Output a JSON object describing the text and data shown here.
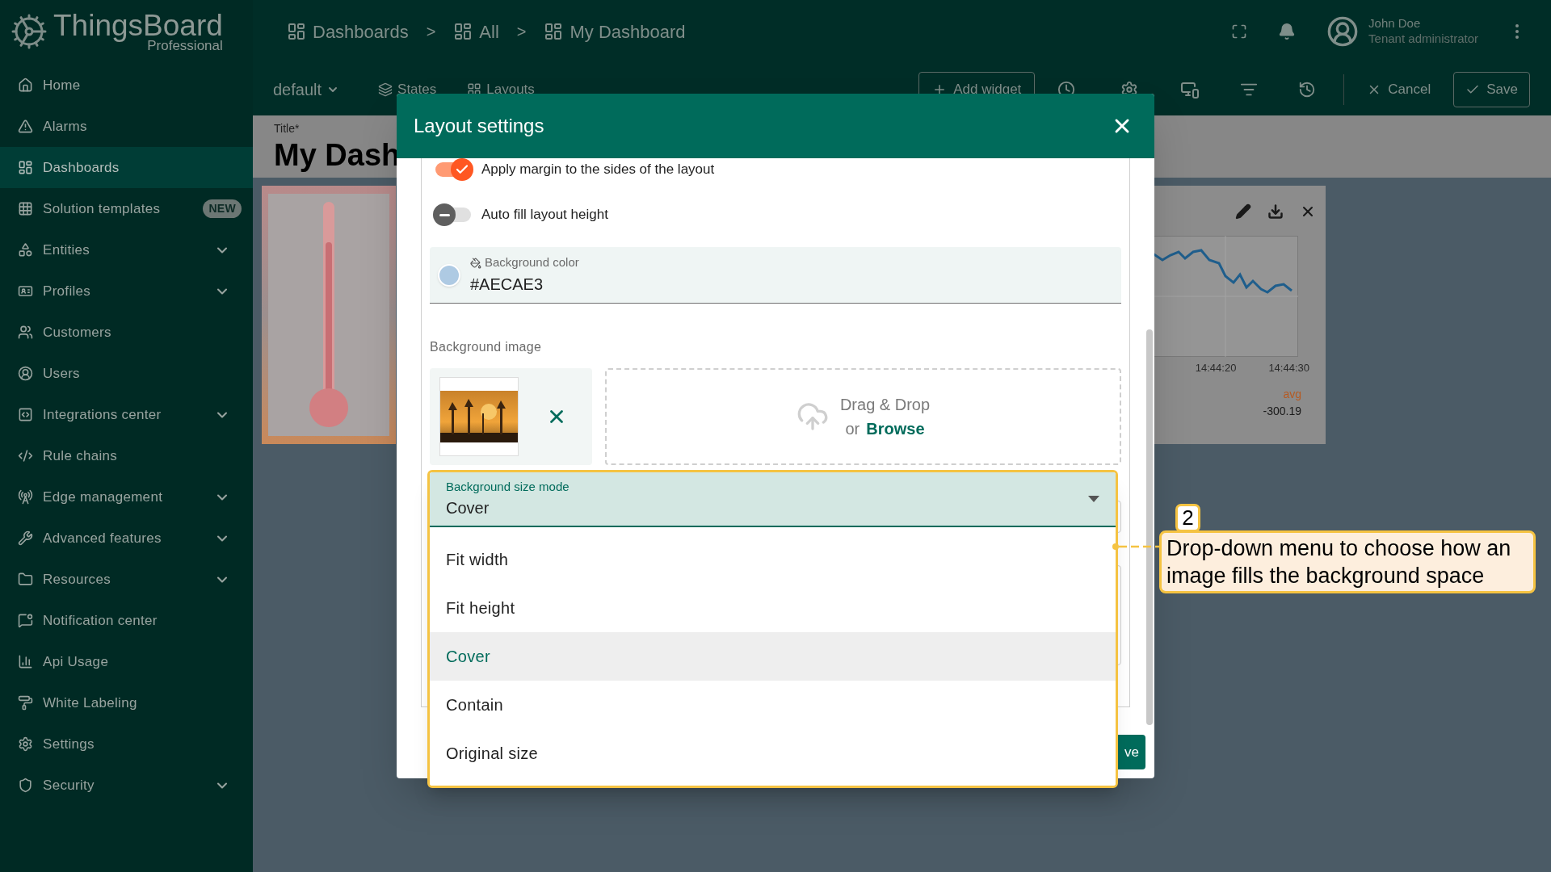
{
  "header": {
    "logo": {
      "name": "ThingsBoard",
      "edition": "Professional"
    },
    "breadcrumbs": [
      {
        "kind": "crumb",
        "label": "Dashboards"
      },
      {
        "kind": "separator",
        "label": ">"
      },
      {
        "kind": "crumb",
        "label": "All"
      },
      {
        "kind": "separator",
        "label": ">"
      },
      {
        "kind": "crumb",
        "label": "My Dashboard"
      }
    ],
    "user": {
      "name": "John Doe",
      "role": "Tenant administrator"
    }
  },
  "sidebar": {
    "items": [
      {
        "label": "Home",
        "selected": false,
        "expandable": false
      },
      {
        "label": "Alarms",
        "selected": false,
        "expandable": false
      },
      {
        "label": "Dashboards",
        "selected": true,
        "expandable": false
      },
      {
        "label": "Solution templates",
        "selected": false,
        "expandable": false,
        "badge": "NEW"
      },
      {
        "label": "Entities",
        "selected": false,
        "expandable": true
      },
      {
        "label": "Profiles",
        "selected": false,
        "expandable": true
      },
      {
        "label": "Customers",
        "selected": false,
        "expandable": false
      },
      {
        "label": "Users",
        "selected": false,
        "expandable": false
      },
      {
        "label": "Integrations center",
        "selected": false,
        "expandable": true
      },
      {
        "label": "Rule chains",
        "selected": false,
        "expandable": false
      },
      {
        "label": "Edge management",
        "selected": false,
        "expandable": true
      },
      {
        "label": "Advanced features",
        "selected": false,
        "expandable": true
      },
      {
        "label": "Resources",
        "selected": false,
        "expandable": true
      },
      {
        "label": "Notification center",
        "selected": false,
        "expandable": false
      },
      {
        "label": "Api Usage",
        "selected": false,
        "expandable": false
      },
      {
        "label": "White Labeling",
        "selected": false,
        "expandable": false
      },
      {
        "label": "Settings",
        "selected": false,
        "expandable": false
      },
      {
        "label": "Security",
        "selected": false,
        "expandable": true
      }
    ]
  },
  "toolbar": {
    "state": "default",
    "links": [
      "States",
      "Layouts"
    ],
    "add_widget": "Add widget",
    "cancel": "Cancel",
    "save": "Save"
  },
  "title_field": {
    "label": "Title*",
    "value": "My Dash"
  },
  "chart_widget": {
    "time_labels": [
      "14:44:20",
      "14:44:30"
    ],
    "legend_label": "avg",
    "legend_value": "-300.19"
  },
  "dialog": {
    "title": "Layout settings",
    "toggles": [
      {
        "label": "Apply margin to the sides of the layout",
        "on": true
      },
      {
        "label": "Auto fill layout height",
        "on": false
      }
    ],
    "background_color": {
      "label": "Background color",
      "value": "#AECAE3"
    },
    "background_image": {
      "label": "Background image",
      "drop_text": "Drag & Drop",
      "or": "or",
      "browse": "Browse"
    },
    "size_mode": {
      "label": "Background size mode",
      "value": "Cover",
      "expanded": true,
      "options": [
        {
          "label": "Fit width",
          "selected": false
        },
        {
          "label": "Fit height",
          "selected": false
        },
        {
          "label": "Cover",
          "selected": true
        },
        {
          "label": "Contain",
          "selected": false
        },
        {
          "label": "Original size",
          "selected": false
        }
      ]
    },
    "footer_button": "ve"
  },
  "annotation": {
    "number": "2",
    "text": "Drop-down menu to choose how an image fills the background space"
  }
}
